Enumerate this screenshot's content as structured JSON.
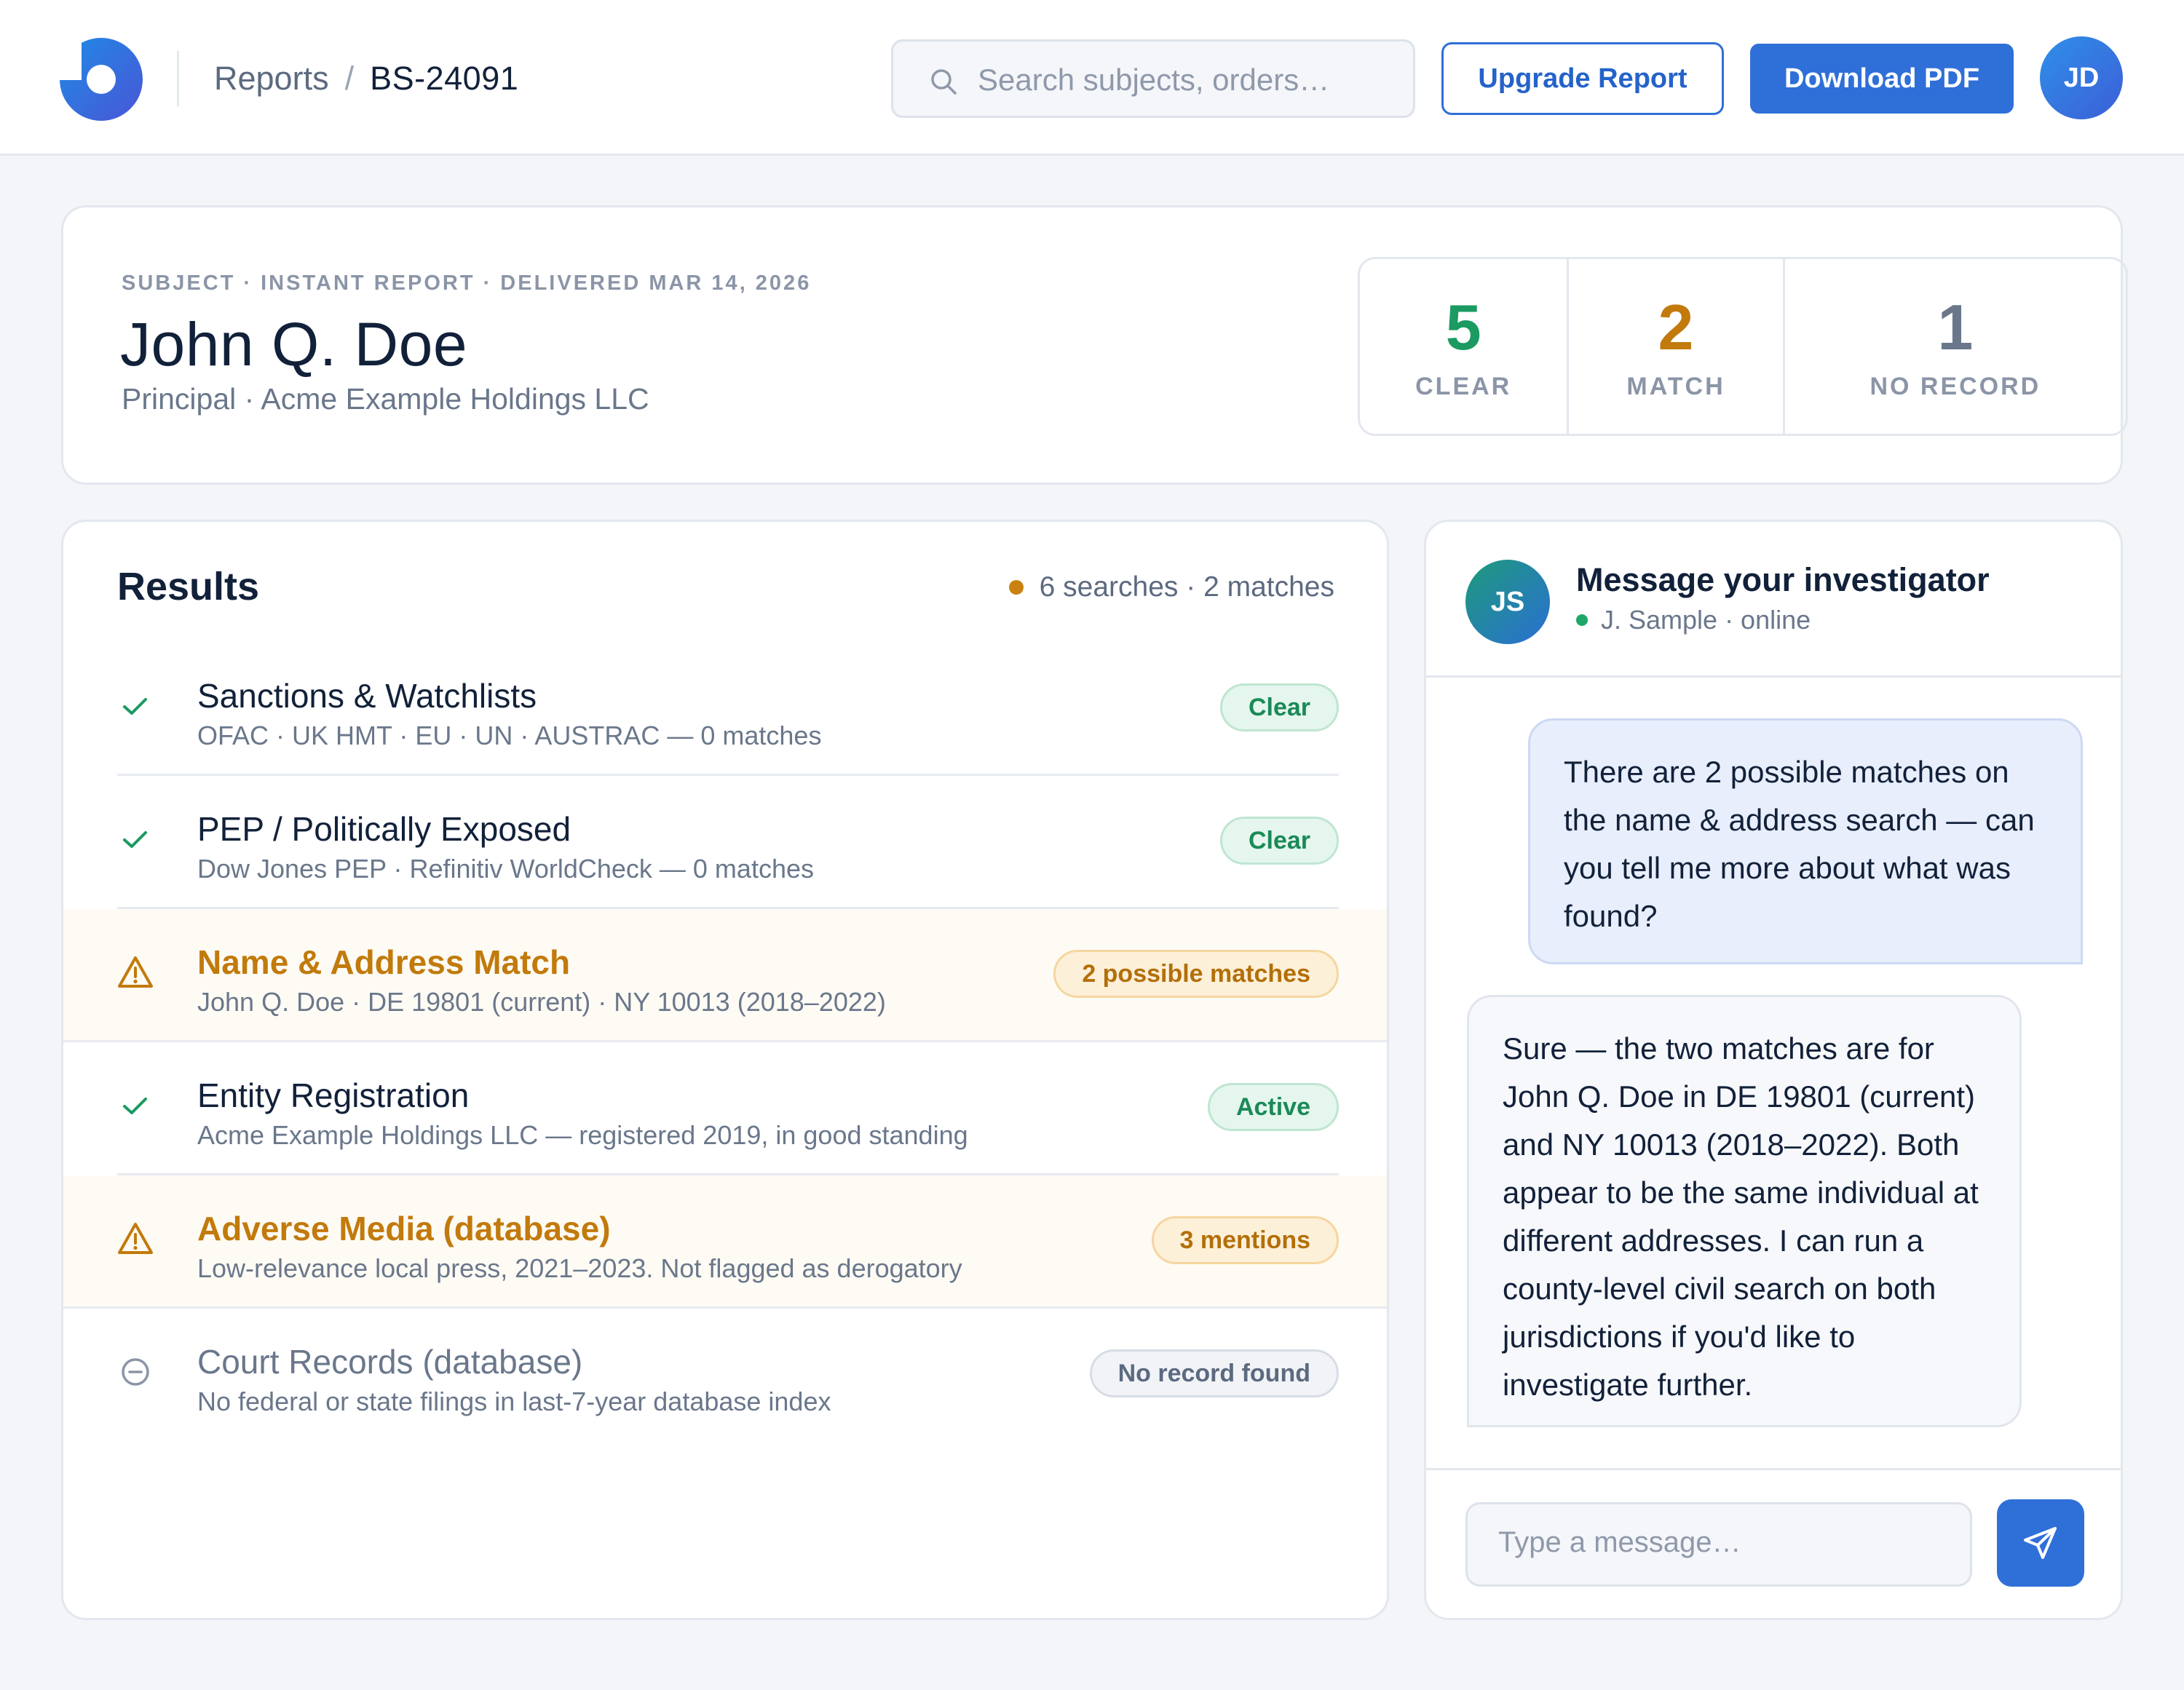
{
  "header": {
    "breadcrumb": {
      "root": "Reports",
      "separator": "/",
      "current": "BS-24091"
    },
    "search": {
      "placeholder": "Search subjects, orders…"
    },
    "upgrade_label": "Upgrade Report",
    "download_label": "Download PDF",
    "user_initials": "JD"
  },
  "subject": {
    "meta": "SUBJECT · INSTANT REPORT · DELIVERED MAR 14, 2026",
    "name": "John Q. Doe",
    "role": "Principal · Acme Example Holdings LLC",
    "stats": [
      {
        "value": "5",
        "label": "CLEAR",
        "color": "#1b9a62"
      },
      {
        "value": "2",
        "label": "MATCH",
        "color": "#c27a0c"
      },
      {
        "value": "1",
        "label": "NO RECORD",
        "color": "#6a778b"
      }
    ]
  },
  "results": {
    "title": "Results",
    "summary": "6 searches · 2 matches",
    "items": [
      {
        "status": "clear",
        "icon": "check-icon",
        "title": "Sanctions & Watchlists",
        "desc": "OFAC · UK HMT · EU · UN · AUSTRAC — 0 matches",
        "badge": "Clear"
      },
      {
        "status": "clear",
        "icon": "check-icon",
        "title": "PEP / Politically Exposed",
        "desc": "Dow Jones PEP · Refinitiv WorldCheck — 0 matches",
        "badge": "Clear"
      },
      {
        "status": "match",
        "icon": "warning-icon",
        "title": "Name & Address Match",
        "desc": "John Q. Doe · DE 19801 (current) · NY 10013 (2018–2022)",
        "badge": "2 possible matches"
      },
      {
        "status": "clear",
        "icon": "check-icon",
        "title": "Entity Registration",
        "desc": "Acme Example Holdings LLC — registered 2019, in good standing",
        "badge": "Active"
      },
      {
        "status": "match",
        "icon": "warning-icon",
        "title": "Adverse Media (database)",
        "desc": "Low-relevance local press, 2021–2023. Not flagged as derogatory",
        "badge": "3 mentions"
      },
      {
        "status": "none",
        "icon": "minus-circle-icon",
        "title": "Court Records (database)",
        "desc": "No federal or state filings in last-7-year database index",
        "badge": "No record found"
      }
    ]
  },
  "chat": {
    "investigator_initials": "JS",
    "title": "Message your investigator",
    "status": "J. Sample · online",
    "messages": [
      {
        "from": "user",
        "text": "There are 2 possible matches on the name & address search — can you tell me more about what was found?"
      },
      {
        "from": "investigator",
        "text": "Sure — the two matches are for John Q. Doe in DE 19801 (current) and NY 10013 (2018–2022). Both appear to be the same individual at different addresses. I can run a county-level civil search on both jurisdictions if you'd like to investigate further."
      }
    ],
    "input_placeholder": "Type a message…"
  }
}
